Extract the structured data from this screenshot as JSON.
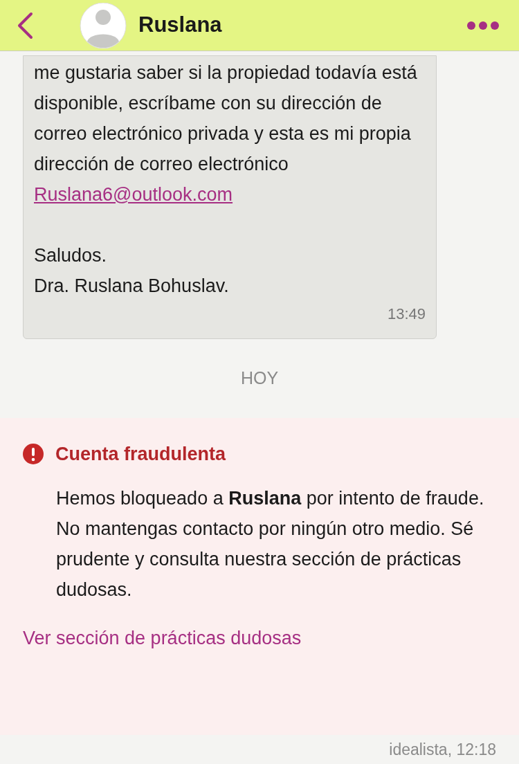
{
  "header": {
    "title": "Ruslana"
  },
  "message": {
    "lines": [
      "me gustaria saber si la propiedad todavía está disponible, escríbame con su dirección de correo electrónico privada y esta es mi propia dirección de correo electrónico"
    ],
    "email": "Ruslana6@outlook.com",
    "signature": [
      "Saludos.",
      "Dra. Ruslana Bohuslav."
    ],
    "time": "13:49"
  },
  "day_separator": "HOY",
  "alert": {
    "title": "Cuenta fraudulenta",
    "body": "Hemos bloqueado a **Ruslana** por intento de fraude. No mantengas contacto por ningún otro medio. Sé prudente y consulta nuestra sección de prácticas dudosas.",
    "link": "Ver sección de prácticas dudosas"
  },
  "footer": "idealista, 12:18"
}
